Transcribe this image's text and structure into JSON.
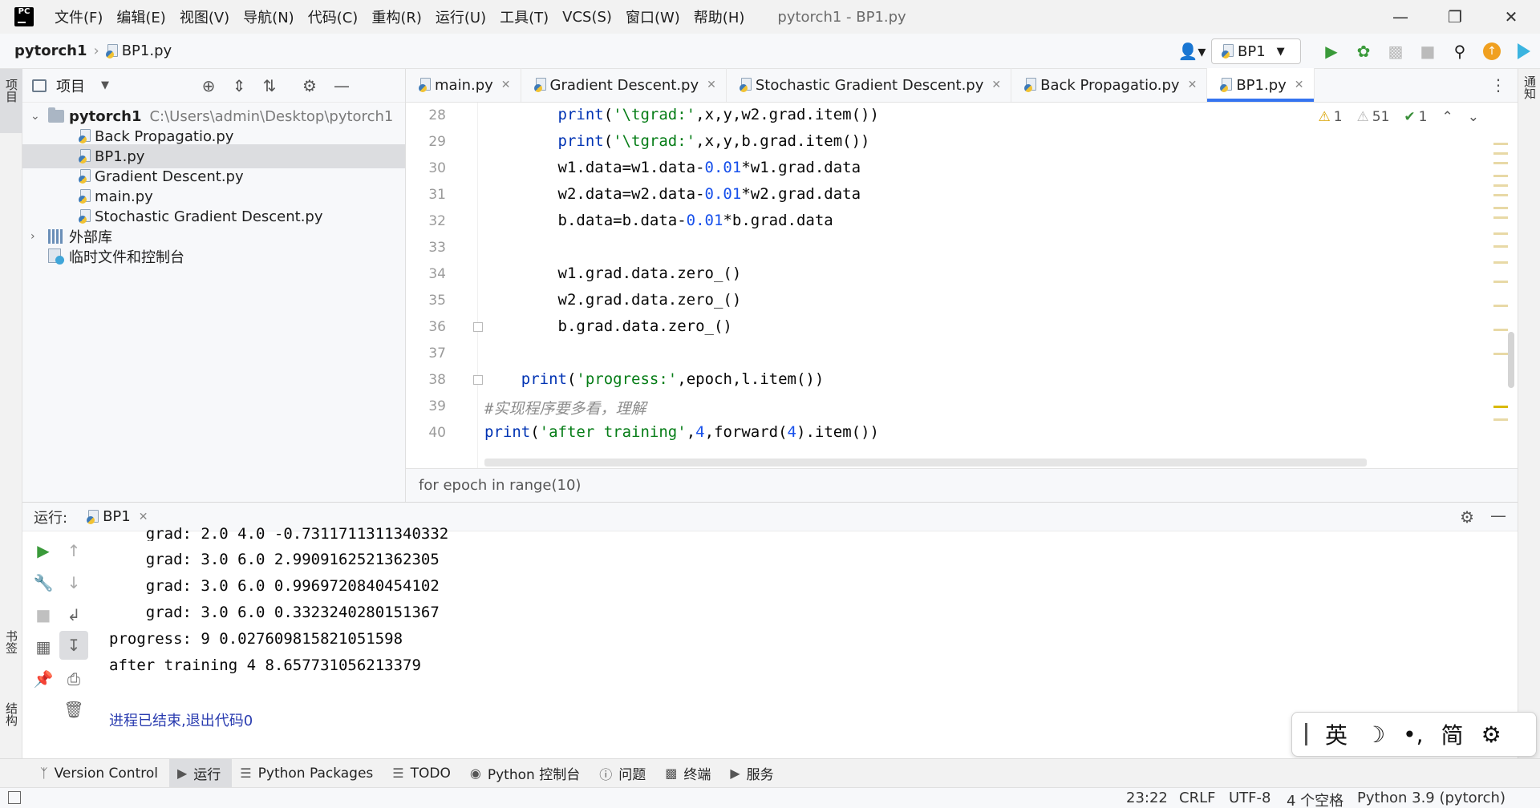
{
  "app": {
    "logo_text": "PC",
    "window_title": "pytorch1 - BP1.py",
    "menu": [
      "文件(F)",
      "编辑(E)",
      "视图(V)",
      "导航(N)",
      "代码(C)",
      "重构(R)",
      "运行(U)",
      "工具(T)",
      "VCS(S)",
      "窗口(W)",
      "帮助(H)"
    ]
  },
  "navbar": {
    "project": "pytorch1",
    "file": "BP1.py",
    "run_config": "BP1"
  },
  "left_strip": {
    "project_tab": "项目",
    "bookmarks_tab": "书签",
    "structure_tab": "结构"
  },
  "right_strip": {
    "notifications_tab": "通知"
  },
  "project_panel": {
    "title": "项目",
    "root": {
      "name": "pytorch1",
      "path": "C:\\Users\\admin\\Desktop\\pytorch1"
    },
    "files": [
      "Back Propagatio.py",
      "BP1.py",
      "Gradient Descent.py",
      "main.py",
      "Stochastic Gradient Descent.py"
    ],
    "selected_file": "BP1.py",
    "external_libs": "外部库",
    "scratches": "临时文件和控制台"
  },
  "editor": {
    "tabs": [
      {
        "label": "main.py",
        "active": false
      },
      {
        "label": "Gradient Descent.py",
        "active": false
      },
      {
        "label": "Stochastic Gradient Descent.py",
        "active": false
      },
      {
        "label": "Back Propagatio.py",
        "active": false
      },
      {
        "label": "BP1.py",
        "active": true
      }
    ],
    "inspections": {
      "errors": "1",
      "warnings": "51",
      "ok": "1"
    },
    "line_numbers": [
      "28",
      "29",
      "30",
      "31",
      "32",
      "33",
      "34",
      "35",
      "36",
      "37",
      "38",
      "39",
      "40"
    ],
    "lines": [
      "        print('\\tgrad:',x,y,w2.grad.item())",
      "        print('\\tgrad:',x,y,b.grad.item())",
      "        w1.data=w1.data-0.01*w1.grad.data",
      "        w2.data=w2.data-0.01*w2.grad.data",
      "        b.data=b.data-0.01*b.grad.data",
      "",
      "        w1.grad.data.zero_()",
      "        w2.grad.data.zero_()",
      "        b.grad.data.zero_()",
      "",
      "    print('progress:',epoch,l.item())",
      "#实现程序要多看，理解",
      "print('after training',4,forward(4).item())"
    ],
    "breadcrumb": "for epoch in range(10)"
  },
  "run_panel": {
    "label": "运行:",
    "tab": "BP1",
    "output": [
      "    grad: 2.0 4.0 -0.7311711311340332",
      "    grad: 3.0 6.0 2.9909162521362305",
      "    grad: 3.0 6.0 0.9969720840454102",
      "    grad: 3.0 6.0 0.3323240280151367",
      "progress: 9 0.027609815821051598",
      "after training 4 8.657731056213379",
      ""
    ],
    "exit_message": "进程已结束,退出代码0"
  },
  "ime": {
    "lang": "英",
    "mode": "☽",
    "punct": "•,",
    "script": "简"
  },
  "tool_bar": [
    "Version Control",
    "运行",
    "Python Packages",
    "TODO",
    "Python 控制台",
    "问题",
    "终端",
    "服务"
  ],
  "status_bar": {
    "position": "23:22",
    "line_sep": "CRLF",
    "encoding": "UTF-8",
    "indent": "4 个空格",
    "interpreter": "Python 3.9 (pytorch)"
  }
}
